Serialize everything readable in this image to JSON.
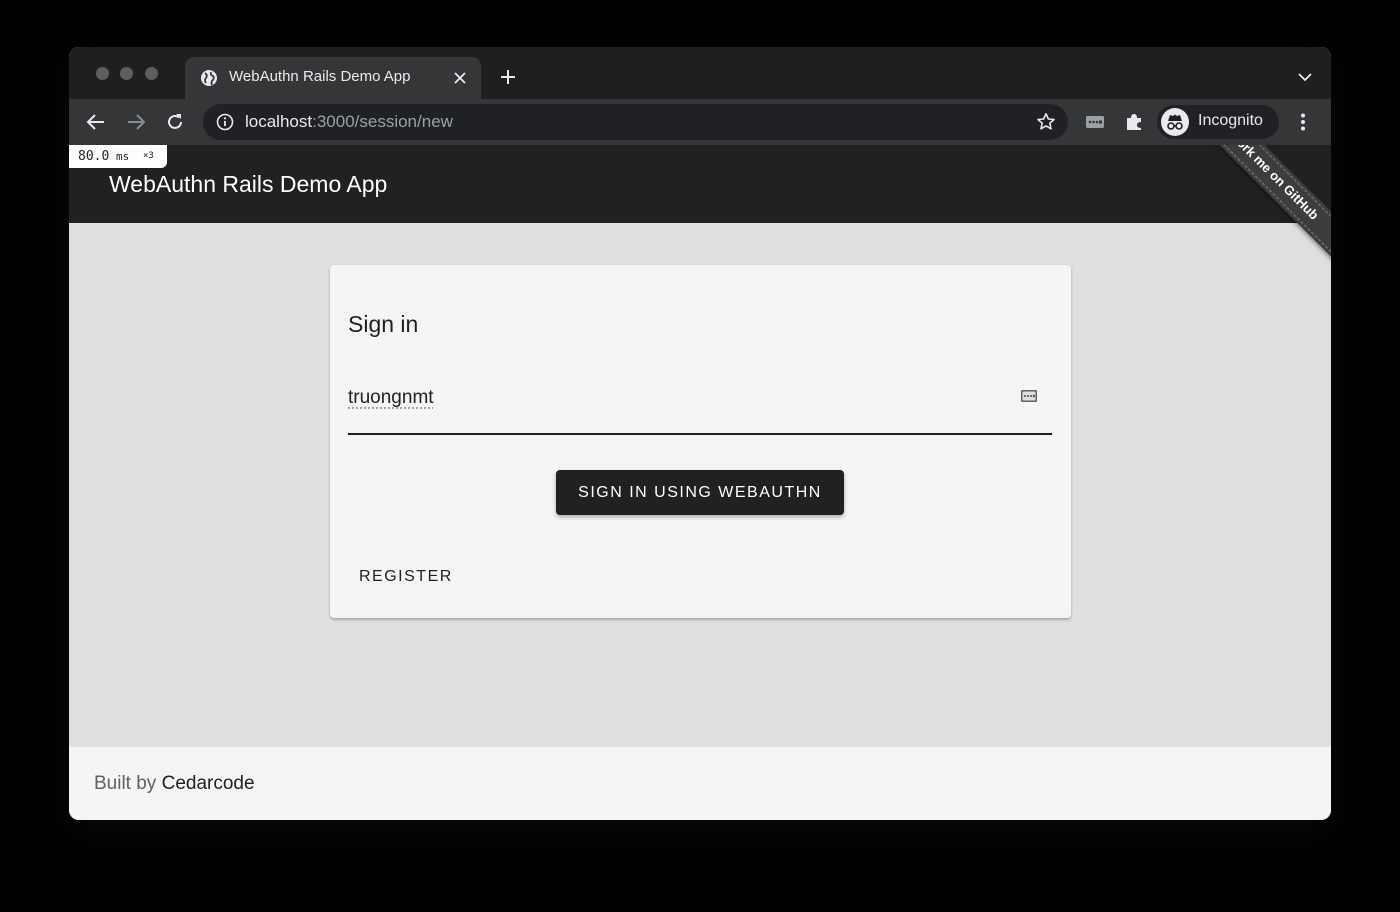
{
  "browser": {
    "tab": {
      "title": "WebAuthn Rails Demo App",
      "icon": "globe-icon"
    },
    "address_bar": {
      "host": "localhost",
      "path": ":3000/session/new"
    },
    "profile": {
      "label": "Incognito"
    },
    "colors": {
      "tabstrip": "#1f1f1f",
      "toolbar": "#353638",
      "omnibox": "#202124"
    }
  },
  "devtools": {
    "timing_value": "80.0",
    "timing_unit": "ms",
    "timing_multiplier": "×3"
  },
  "app": {
    "title": "WebAuthn Rails Demo App",
    "ribbon": "Fork me on GitHub"
  },
  "signin": {
    "heading": "Sign in",
    "username": "truongnmt",
    "submit_label": "SIGN IN USING WEBAUTHN",
    "register_label": "REGISTER"
  },
  "footer": {
    "prefix": "Built by ",
    "link": "Cedarcode"
  },
  "colors": {
    "app_bar": "#212121",
    "page_background": "#e0e0e0",
    "card_background": "#f5f5f5",
    "primary_button": "#212121"
  }
}
